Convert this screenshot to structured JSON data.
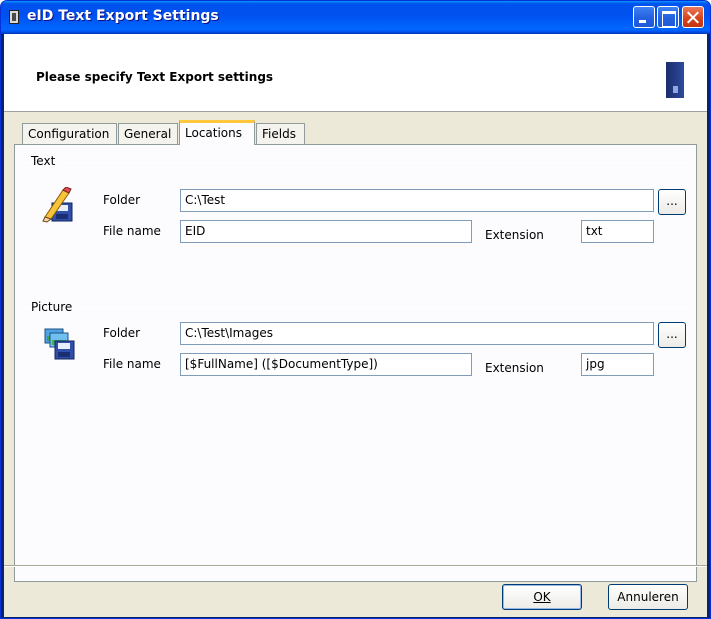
{
  "window": {
    "title": "eID Text Export Settings"
  },
  "header": {
    "title": "Please specify Text Export settings"
  },
  "tabs": [
    {
      "label": "Configuration",
      "active": false
    },
    {
      "label": "General",
      "active": false
    },
    {
      "label": "Locations",
      "active": true
    },
    {
      "label": "Fields",
      "active": false
    }
  ],
  "text_group": {
    "label": "Text",
    "folder_label": "Folder",
    "folder_value": "C:\\Test",
    "filename_label": "File name",
    "filename_value": "EID",
    "extension_label": "Extension",
    "extension_value": "txt",
    "browse_label": "..."
  },
  "picture_group": {
    "label": "Picture",
    "folder_label": "Folder",
    "folder_value": "C:\\Test\\Images",
    "filename_label": "File name",
    "filename_value": "[$FullName] ([$DocumentType])",
    "extension_label": "Extension",
    "extension_value": "jpg",
    "browse_label": "..."
  },
  "buttons": {
    "ok_label": "OK",
    "cancel_label": "Annuleren"
  },
  "icons": {
    "text_export": "pencil-floppy-icon",
    "picture_export": "images-floppy-icon"
  }
}
